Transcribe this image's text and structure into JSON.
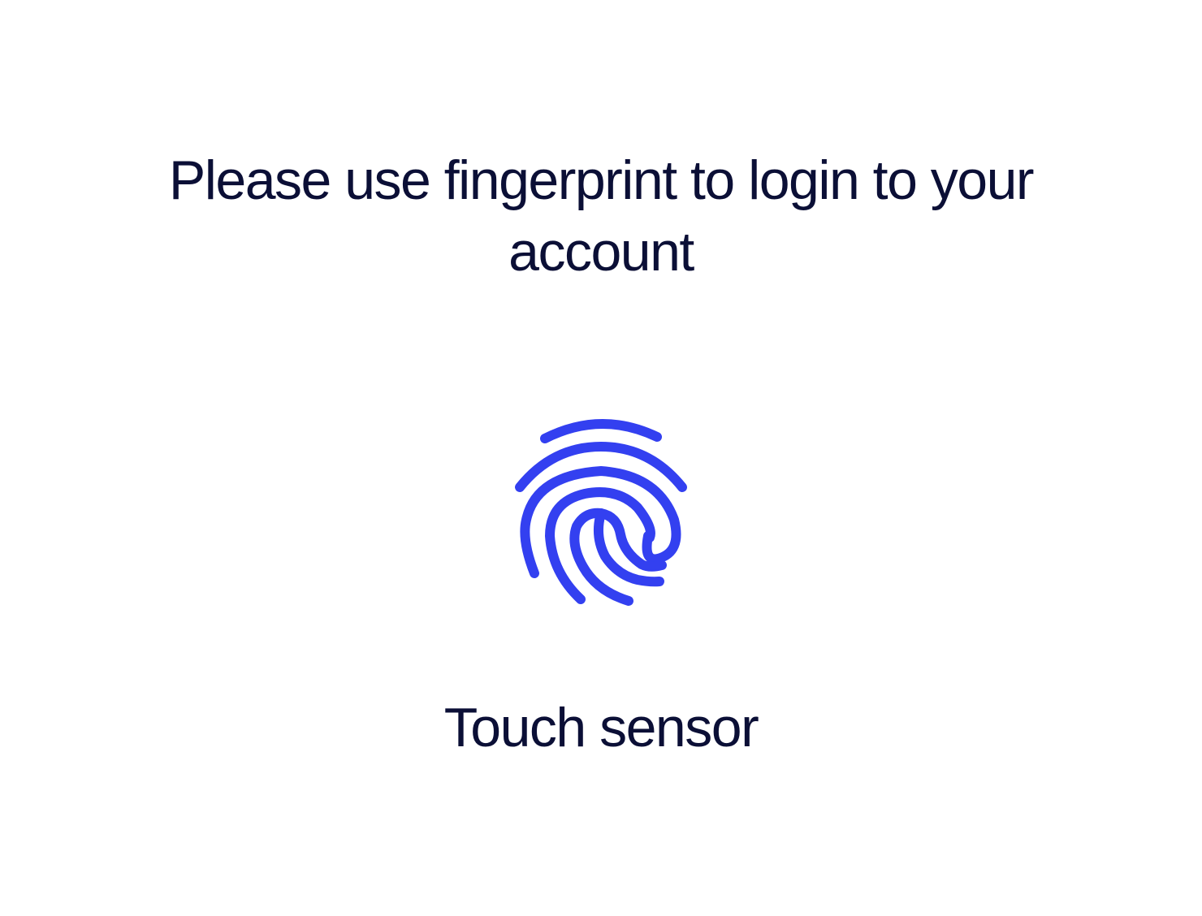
{
  "prompt": {
    "text": "Please use fingerprint to login to your account"
  },
  "sensor": {
    "label": "Touch sensor",
    "icon": "fingerprint-icon",
    "color": "#3340f0"
  },
  "colors": {
    "background": "#ffffff",
    "text": "#0b0f36",
    "accent": "#3340f0"
  }
}
